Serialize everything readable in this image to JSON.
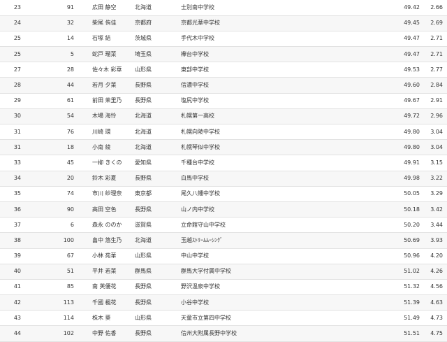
{
  "rows": [
    {
      "rank": "23",
      "num": "91",
      "name": "広田 静空",
      "pref": "北海道",
      "school": "士別南中学校",
      "time": "49.42",
      "gap": "2.66"
    },
    {
      "rank": "24",
      "num": "32",
      "name": "柴尾 侑佳",
      "pref": "京都府",
      "school": "京都光華中学校",
      "time": "49.45",
      "gap": "2.69"
    },
    {
      "rank": "25",
      "num": "14",
      "name": "石塚 結",
      "pref": "茨城県",
      "school": "手代木中学校",
      "time": "49.47",
      "gap": "2.71"
    },
    {
      "rank": "25",
      "num": "5",
      "name": "蛇戸 瑠菜",
      "pref": "埼玉県",
      "school": "欅台中学校",
      "time": "49.47",
      "gap": "2.71"
    },
    {
      "rank": "27",
      "num": "28",
      "name": "佐々木 彩華",
      "pref": "山形県",
      "school": "東部中学校",
      "time": "49.53",
      "gap": "2.77"
    },
    {
      "rank": "28",
      "num": "44",
      "name": "若月 夕菜",
      "pref": "長野県",
      "school": "信濃中学校",
      "time": "49.60",
      "gap": "2.84"
    },
    {
      "rank": "29",
      "num": "61",
      "name": "前田 茉里乃",
      "pref": "長野県",
      "school": "塩尻中学校",
      "time": "49.67",
      "gap": "2.91"
    },
    {
      "rank": "30",
      "num": "54",
      "name": "木場 海怜",
      "pref": "北海道",
      "school": "札幌第一高校",
      "time": "49.72",
      "gap": "2.96"
    },
    {
      "rank": "31",
      "num": "76",
      "name": "川崎 環",
      "pref": "北海道",
      "school": "札幌向陵中学校",
      "time": "49.80",
      "gap": "3.04"
    },
    {
      "rank": "31",
      "num": "18",
      "name": "小南 綾",
      "pref": "北海道",
      "school": "札幌琴似中学校",
      "time": "49.80",
      "gap": "3.04"
    },
    {
      "rank": "33",
      "num": "45",
      "name": "一柳 きくの",
      "pref": "愛知県",
      "school": "千種台中学校",
      "time": "49.91",
      "gap": "3.15"
    },
    {
      "rank": "34",
      "num": "20",
      "name": "鈴木 彩夏",
      "pref": "長野県",
      "school": "白馬中学校",
      "time": "49.98",
      "gap": "3.22"
    },
    {
      "rank": "35",
      "num": "74",
      "name": "市川 紗理奈",
      "pref": "東京都",
      "school": "尾久八幡中学校",
      "time": "50.05",
      "gap": "3.29"
    },
    {
      "rank": "36",
      "num": "90",
      "name": "高田 空色",
      "pref": "長野県",
      "school": "山ノ内中学校",
      "time": "50.18",
      "gap": "3.42"
    },
    {
      "rank": "37",
      "num": "6",
      "name": "森永 ののか",
      "pref": "滋賀県",
      "school": "立命館守山中学校",
      "time": "50.20",
      "gap": "3.44"
    },
    {
      "rank": "38",
      "num": "100",
      "name": "畠中 悠生乃",
      "pref": "北海道",
      "school": "玉越ｽﾄﾘｰﾑﾑｰｼﾝｸﾞ",
      "time": "50.69",
      "gap": "3.93"
    },
    {
      "rank": "39",
      "num": "67",
      "name": "小林 苑華",
      "pref": "山形県",
      "school": "中山中学校",
      "time": "50.96",
      "gap": "4.20"
    },
    {
      "rank": "40",
      "num": "51",
      "name": "平井 若菜",
      "pref": "群馬県",
      "school": "群馬大学付属中学校",
      "time": "51.02",
      "gap": "4.26"
    },
    {
      "rank": "41",
      "num": "85",
      "name": "南 芙優花",
      "pref": "長野県",
      "school": "野沢温泉中学校",
      "time": "51.32",
      "gap": "4.56"
    },
    {
      "rank": "42",
      "num": "113",
      "name": "千國 楓花",
      "pref": "長野県",
      "school": "小谷中学校",
      "time": "51.39",
      "gap": "4.63"
    },
    {
      "rank": "43",
      "num": "114",
      "name": "株木 葵",
      "pref": "山形県",
      "school": "天童市立第四中学校",
      "time": "51.49",
      "gap": "4.73"
    },
    {
      "rank": "44",
      "num": "102",
      "name": "中野 佑香",
      "pref": "長野県",
      "school": "信州大附属長野中学校",
      "time": "51.51",
      "gap": "4.75"
    }
  ]
}
